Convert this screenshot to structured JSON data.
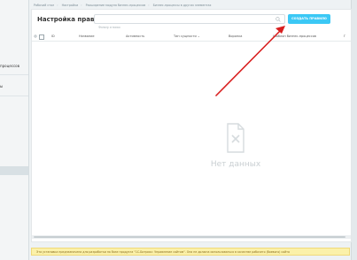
{
  "breadcrumb": [
    "Рабочий стол",
    "Настройки",
    "Расширение модуля бизнес-процессов",
    "Бизнес-процессы в других элементах"
  ],
  "sidebar": {
    "items": [
      "процессов",
      "ы"
    ]
  },
  "page": {
    "title": "Настройка правил"
  },
  "search": {
    "placeholder": "Фильтр и поиск"
  },
  "toolbar": {
    "create_label": "СОЗДАТЬ ПРАВИЛО"
  },
  "table": {
    "columns": [
      "ID",
      "Название",
      "Активность",
      "Тип сущности",
      "Воронка",
      "Шаблон бизнес-процессов",
      "Г"
    ],
    "sort_indicator": "⌄"
  },
  "empty_state": {
    "text": "Нет данных"
  },
  "footer": {
    "warning": "Эта установка предназначена для разработки на базе продукта \"1С-Битрикс: Управление сайтом\". Она не должна использоваться в качестве рабочего (боевого) сайта"
  },
  "colors": {
    "accent": "#3bc8f5",
    "arrow": "#d81e1e",
    "warning_bg": "#fbf1a9"
  }
}
